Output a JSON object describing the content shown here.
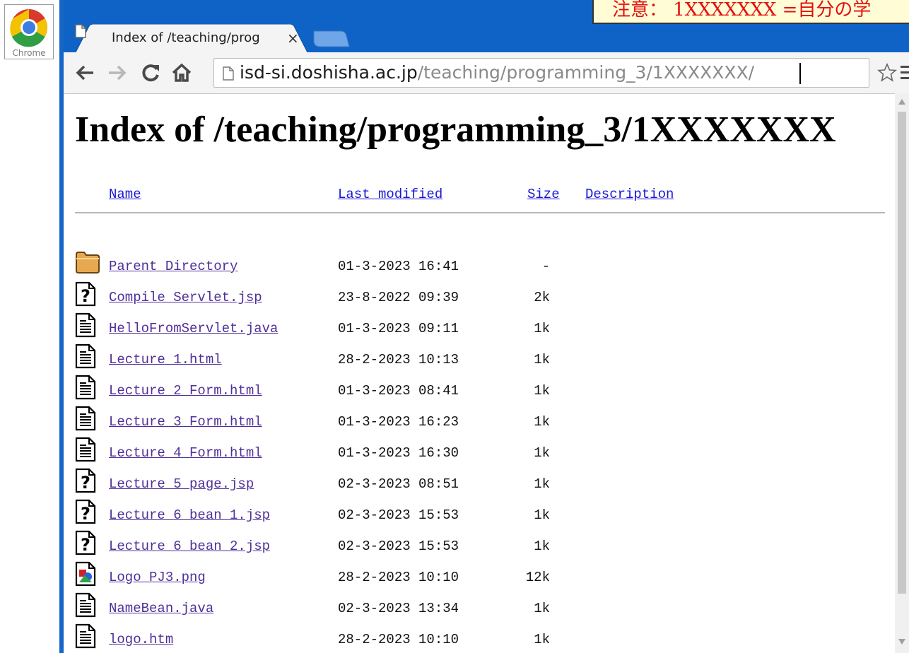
{
  "app_icon": {
    "label": "Chrome"
  },
  "notice": {
    "text": "注意： 1XXXXXXX =自分の学"
  },
  "tab": {
    "title": "Index of /teaching/prog",
    "close": "×"
  },
  "toolbar": {
    "url_host": "isd-si.doshisha.ac.jp",
    "url_path": "/teaching/programming_3/1XXXXXXX/"
  },
  "page": {
    "title": "Index of /teaching/programming_3/1XXXXXXX",
    "headers": {
      "name": "Name",
      "last_modified": "Last modified",
      "size": "Size",
      "description": "Description"
    },
    "entries": [
      {
        "icon": "folder-icon",
        "name": "Parent Directory",
        "date": "01-3-2023 16:41",
        "size": "-"
      },
      {
        "icon": "unknown-file-icon",
        "name": "Compile_Servlet.jsp",
        "date": "23-8-2022 09:39",
        "size": "2k"
      },
      {
        "icon": "text-file-icon",
        "name": "HelloFromServlet.java",
        "date": "01-3-2023 09:11",
        "size": "1k"
      },
      {
        "icon": "text-file-icon",
        "name": "Lecture_1.html",
        "date": "28-2-2023 10:13",
        "size": "1k"
      },
      {
        "icon": "text-file-icon",
        "name": "Lecture_2_Form.html",
        "date": "01-3-2023 08:41",
        "size": "1k"
      },
      {
        "icon": "text-file-icon",
        "name": "Lecture_3_Form.html",
        "date": "01-3-2023 16:23",
        "size": "1k"
      },
      {
        "icon": "text-file-icon",
        "name": "Lecture_4_Form.html",
        "date": "01-3-2023 16:30",
        "size": "1k"
      },
      {
        "icon": "unknown-file-icon",
        "name": "Lecture_5_page.jsp",
        "date": "02-3-2023 08:51",
        "size": "1k"
      },
      {
        "icon": "unknown-file-icon",
        "name": "Lecture_6_bean_1.jsp",
        "date": "02-3-2023 15:53",
        "size": "1k"
      },
      {
        "icon": "unknown-file-icon",
        "name": "Lecture_6_bean_2.jsp",
        "date": "02-3-2023 15:53",
        "size": "1k"
      },
      {
        "icon": "image-file-icon",
        "name": "Logo_PJ3.png",
        "date": "28-2-2023 10:10",
        "size": "12k"
      },
      {
        "icon": "text-file-icon",
        "name": "NameBean.java",
        "date": "02-3-2023 13:34",
        "size": "1k"
      },
      {
        "icon": "text-file-icon",
        "name": "logo.htm",
        "date": "28-2-2023 10:10",
        "size": "1k"
      }
    ]
  }
}
